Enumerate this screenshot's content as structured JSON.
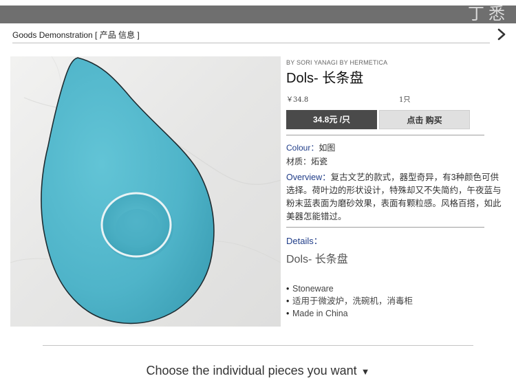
{
  "header": {
    "corner_logo": "丁悉"
  },
  "breadcrumb": {
    "text": "Goods  Demonstration [ 产品 信息 ]"
  },
  "product": {
    "brand": "BY SORI YANAGI BY HERMETICA",
    "title": "Dols- 长条盘",
    "price_small": "￥34.8",
    "qty_small": "1只",
    "price_button": "34.8元 /只",
    "buy_button": "点击 购买",
    "colour_label": "Colour：",
    "colour_value": "如图",
    "material_label": "材质：",
    "material_value": "炻瓷",
    "overview_label": "Overview：",
    "overview_text": "复古文艺的款式，器型奇异，有3种颜色可供选择。荷叶边的形状设计，特殊却又不失简约，午夜蓝与粉末蓝表面为磨砂效果，表面有颗粒感。风格百搭，如此美器怎能错过。",
    "details_label": "Details：",
    "details_name": "Dols- 长条盘",
    "features": [
      "Stoneware",
      "适用于微波炉，洗碗机，消毒柜",
      "Made in China"
    ]
  },
  "footer": {
    "choose_text": "Choose the individual pieces you want"
  },
  "icons": {
    "next": "chevron-right-icon",
    "dropdown": "caret-down-icon"
  },
  "colors": {
    "accent_blue": "#1f3c88",
    "price_button": "#4a4a4a",
    "plate": "#4fb4c9"
  }
}
